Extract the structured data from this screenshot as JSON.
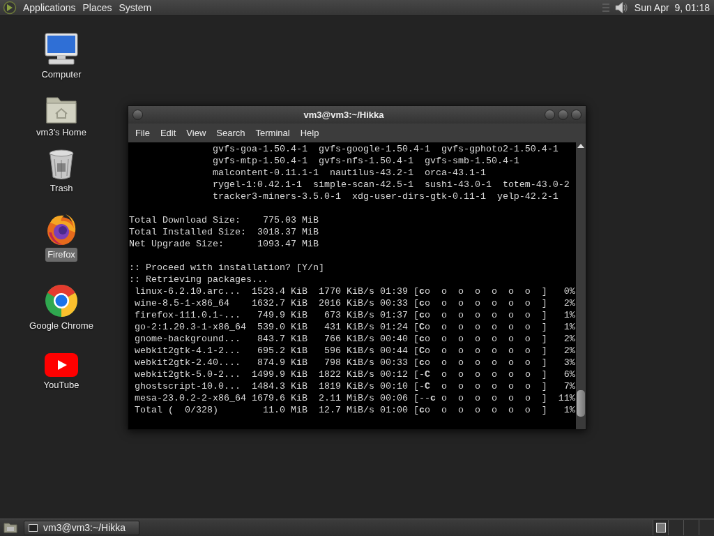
{
  "top_panel": {
    "menus": [
      "Applications",
      "Places",
      "System"
    ],
    "clock": "Sun Apr  9, 01:18"
  },
  "desktop_icons": [
    {
      "kind": "computer",
      "label": "Computer",
      "selected": false
    },
    {
      "kind": "home",
      "label": "vm3's Home",
      "selected": false
    },
    {
      "kind": "trash",
      "label": "Trash",
      "selected": false
    },
    {
      "kind": "firefox",
      "label": "Firefox",
      "selected": true
    },
    {
      "kind": "chrome",
      "label": "Google Chrome",
      "selected": false
    },
    {
      "kind": "youtube",
      "label": "YouTube",
      "selected": false
    }
  ],
  "terminal": {
    "title": "vm3@vm3:~/Hikka",
    "menu": [
      "File",
      "Edit",
      "View",
      "Search",
      "Terminal",
      "Help"
    ],
    "blocks": [
      [
        "               gvfs-goa-1.50.4-1  gvfs-google-1.50.4-1  gvfs-gphoto2-1.50.4-1",
        "               gvfs-mtp-1.50.4-1  gvfs-nfs-1.50.4-1  gvfs-smb-1.50.4-1",
        "               malcontent-0.11.1-1  nautilus-43.2-1  orca-43.1-1",
        "               rygel-1:0.42.1-1  simple-scan-42.5-1  sushi-43.0-1  totem-43.0-2",
        "               tracker3-miners-3.5.0-1  xdg-user-dirs-gtk-0.11-1  yelp-42.2-1"
      ],
      [
        "Total Download Size:    775.03 MiB",
        "Total Installed Size:  3018.37 MiB",
        "Net Upgrade Size:      1093.47 MiB"
      ],
      [
        ":: Proceed with installation? [Y/n]",
        ":: Retrieving packages...",
        " linux-6.2.10.arc...  1523.4 KiB  1770 KiB/s 01:39 [**c**o  o  o  o  o  o  o  ]   0%",
        " wine-8.5-1-x86_64    1632.7 KiB  2016 KiB/s 00:33 [**c**o  o  o  o  o  o  o  ]   2%",
        " firefox-111.0.1-...   749.9 KiB   673 KiB/s 01:37 [**c**o  o  o  o  o  o  o  ]   1%",
        " go-2:1.20.3-1-x86_64  539.0 KiB   431 KiB/s 01:24 [**C**o  o  o  o  o  o  o  ]   1%",
        " gnome-background...   843.7 KiB   766 KiB/s 00:40 [**c**o  o  o  o  o  o  o  ]   2%",
        " webkit2gtk-4.1-2...   695.2 KiB   596 KiB/s 00:44 [**C**o  o  o  o  o  o  o  ]   2%",
        " webkit2gtk-2.40....   874.9 KiB   798 KiB/s 00:33 [**c**o  o  o  o  o  o  o  ]   3%",
        " webkit2gtk-5.0-2...  1499.9 KiB  1822 KiB/s 00:12 [-**C**  o  o  o  o  o  o  ]   6%",
        " ghostscript-10.0...  1484.3 KiB  1819 KiB/s 00:10 [-**C**  o  o  o  o  o  o  ]   7%",
        " mesa-23.0.2-2-x86_64 1679.6 KiB  2.11 MiB/s 00:06 [--**c** o  o  o  o  o  o  ]  11%",
        " Total (  0/328)        11.0 MiB  12.7 MiB/s 01:00 [**c**o  o  o  o  o  o  o  ]   1%"
      ]
    ]
  },
  "taskbar": {
    "tasks": [
      {
        "label": "vm3@vm3:~/Hikka",
        "selected": false
      }
    ],
    "workspaces": [
      {
        "selected": true
      },
      {
        "selected": false
      },
      {
        "selected": false
      },
      {
        "selected": false
      }
    ]
  }
}
